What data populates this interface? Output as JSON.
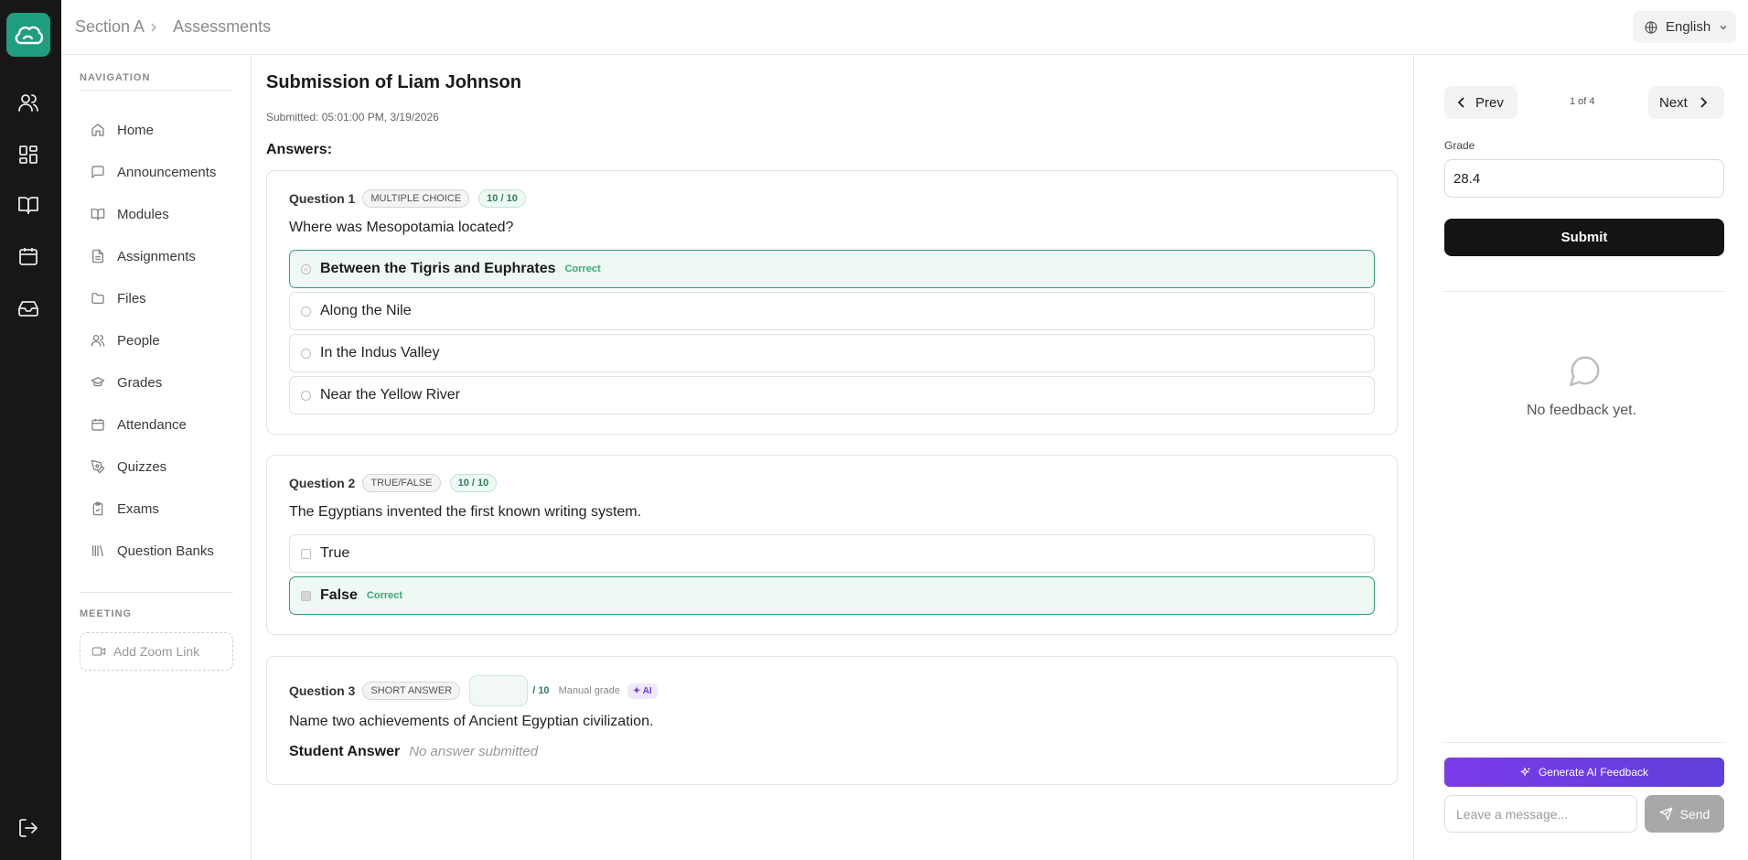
{
  "breadcrumb": {
    "section": "Section A",
    "page": "Assessments"
  },
  "language": {
    "label": "English"
  },
  "nav": {
    "heading": "NAVIGATION",
    "items": [
      {
        "label": "Home",
        "icon": "home-icon"
      },
      {
        "label": "Announcements",
        "icon": "message-icon"
      },
      {
        "label": "Modules",
        "icon": "book-icon"
      },
      {
        "label": "Assignments",
        "icon": "file-icon"
      },
      {
        "label": "Files",
        "icon": "folder-icon"
      },
      {
        "label": "People",
        "icon": "users-icon"
      },
      {
        "label": "Grades",
        "icon": "graduation-cap-icon"
      },
      {
        "label": "Attendance",
        "icon": "calendar-icon"
      },
      {
        "label": "Quizzes",
        "icon": "pen-icon"
      },
      {
        "label": "Exams",
        "icon": "clipboard-check-icon"
      },
      {
        "label": "Question Banks",
        "icon": "library-icon"
      }
    ],
    "meeting_heading": "MEETING",
    "zoom_label": "Add Zoom Link"
  },
  "submission": {
    "title": "Submission of Liam Johnson",
    "submitted": "Submitted: 05:01:00 PM, 3/19/2026",
    "answers_label": "Answers:"
  },
  "questions": [
    {
      "number": "Question 1",
      "type": "MULTIPLE CHOICE",
      "score": "10 / 10",
      "text": "Where was Mesopotamia located?",
      "options": [
        {
          "text": "Between the Tigris and Euphrates",
          "tag": "Correct"
        },
        {
          "text": "Along the Nile"
        },
        {
          "text": "In the Indus Valley"
        },
        {
          "text": "Near the Yellow River"
        }
      ]
    },
    {
      "number": "Question 2",
      "type": "TRUE/FALSE",
      "score": "10 / 10",
      "text": "The Egyptians invented the first known writing system.",
      "options": [
        {
          "text": "True"
        },
        {
          "text": "False",
          "tag": "Correct"
        }
      ]
    },
    {
      "number": "Question 3",
      "type": "SHORT ANSWER",
      "grade_value": "",
      "grade_of": "/ 10",
      "manual_label": "Manual grade",
      "ai_label": "✦ AI",
      "text": "Name two achievements of Ancient Egyptian civilization.",
      "student_answer_label": "Student Answer",
      "student_answer": "No answer submitted"
    }
  ],
  "panel": {
    "prev_label": "Prev",
    "next_label": "Next",
    "pager": "1 of 4",
    "grade_label": "Grade",
    "grade_value": "28.4",
    "submit_label": "Submit",
    "no_feedback": "No feedback yet.",
    "ai_feedback_label": "Generate AI Feedback",
    "message_placeholder": "Leave a message...",
    "send_label": "Send"
  },
  "colors": {
    "rail": "#171717",
    "brand": "#1f9e80",
    "correct_border": "#2e9e73",
    "correct_bg": "#eef9f4",
    "ai_purple": "#7b3bea"
  }
}
